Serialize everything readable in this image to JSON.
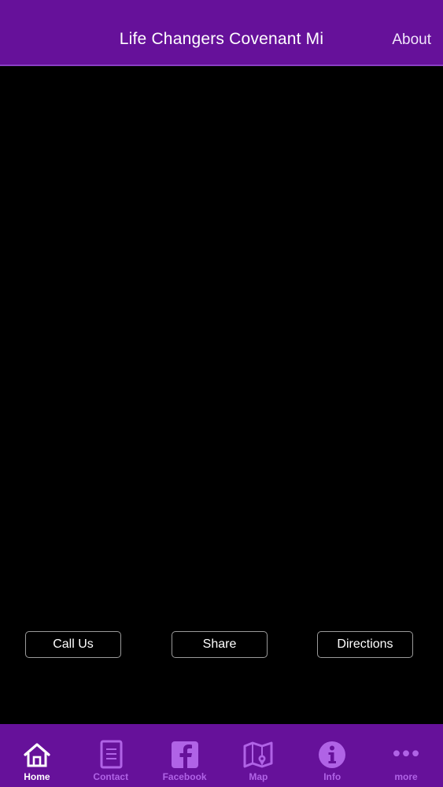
{
  "header": {
    "title": "Life Changers Covenant Mi",
    "about_label": "About"
  },
  "actions": {
    "call_label": "Call Us",
    "share_label": "Share",
    "directions_label": "Directions"
  },
  "tabbar": {
    "active": "Home",
    "tabs": [
      {
        "label": "Home",
        "icon": "home-icon"
      },
      {
        "label": "Contact",
        "icon": "contact-card-icon"
      },
      {
        "label": "Facebook",
        "icon": "facebook-icon"
      },
      {
        "label": "Map",
        "icon": "map-icon"
      },
      {
        "label": "Info",
        "icon": "info-icon"
      },
      {
        "label": "more",
        "icon": "more-dots-icon"
      }
    ]
  },
  "colors": {
    "header_bg": "#66119a",
    "tabbar_bg": "#66119a",
    "tab_inactive": "#b063e6",
    "tab_active": "#ffffff",
    "content_bg": "#000000"
  }
}
